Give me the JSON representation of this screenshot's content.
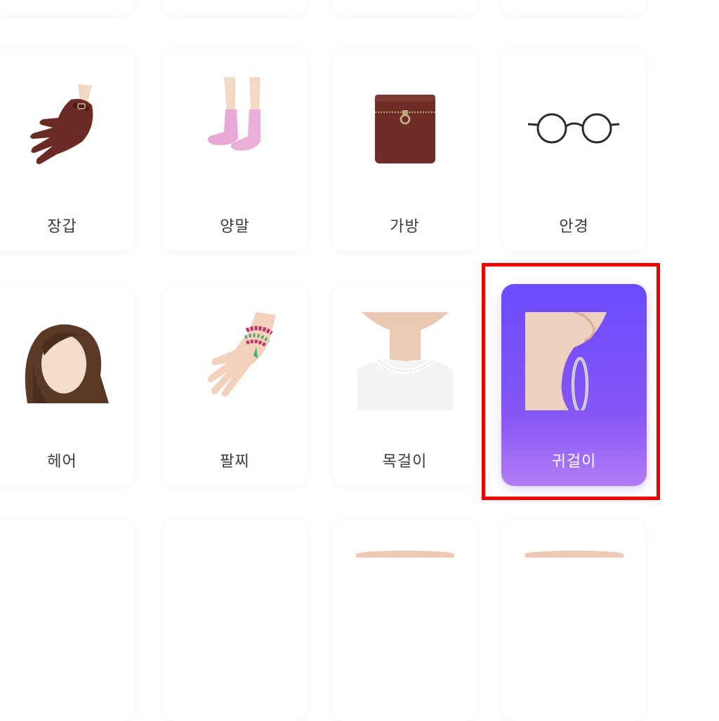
{
  "items": [
    {
      "label": "장갑",
      "icon": "glove-icon"
    },
    {
      "label": "양말",
      "icon": "socks-icon"
    },
    {
      "label": "가방",
      "icon": "bag-icon"
    },
    {
      "label": "안경",
      "icon": "glasses-icon"
    },
    {
      "label": "헤어",
      "icon": "hair-icon"
    },
    {
      "label": "팔찌",
      "icon": "bracelet-icon"
    },
    {
      "label": "목걸이",
      "icon": "necklace-icon"
    },
    {
      "label": "귀걸이",
      "icon": "earring-icon",
      "selected": true
    }
  ],
  "colors": {
    "selected_gradient_top": "#6b4bff",
    "selected_gradient_bottom": "#b27cf5",
    "highlight_border": "#f20000"
  }
}
